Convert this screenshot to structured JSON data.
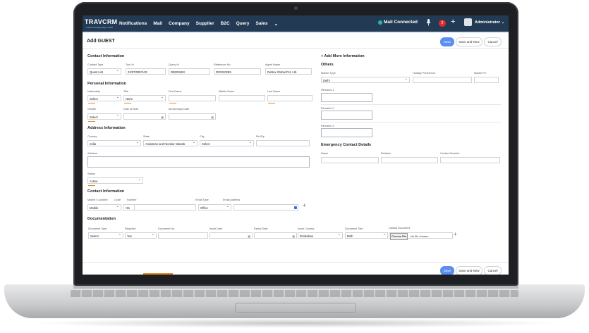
{
  "topbar": {
    "logo": "TRAVCRM",
    "logo_sub": "Travel & Holiday Mgmt CRM",
    "nav": [
      "Notifications",
      "Mail",
      "Company",
      "Supplier",
      "B2C",
      "Query",
      "Sales"
    ],
    "mail_status": "Mail Connected",
    "notifications_count": "2",
    "user": "Administrator"
  },
  "page": {
    "title": "Add GUEST",
    "save": "Save",
    "save_new": "Save and New",
    "cancel": "Cancel"
  },
  "contact_info": {
    "title": "Contact Information",
    "contact_type_label": "Contact Type",
    "contact_type": "Quest List",
    "tour_id_label": "Tour Id",
    "tour_id": "22/07/0007/AD",
    "query_id_label": "Query Id",
    "query_id": "DB200453",
    "ref_label": "Reference No",
    "ref": "R20220255",
    "agent_label": "Agent Name",
    "agent": "DeBox Global Pvt. Ltd."
  },
  "personal": {
    "title": "Personal Information",
    "nationality_label": "Nationality",
    "nationality": "Select",
    "title_label": "Title",
    "title_value": "None",
    "first_label": "First Name",
    "middle_label": "Middle Name",
    "last_label": "Last Name",
    "gender_label": "Gender",
    "gender": "Select",
    "dob_label": "Date of Birth",
    "anniv_label": "Anniversary Date"
  },
  "address": {
    "title": "Address Information",
    "country_label": "Country",
    "country": "India",
    "state_label": "State",
    "state": "Andaman and Nicobar Islands",
    "city_label": "City",
    "city": "Select",
    "pin_label": "Pin/Zip",
    "address_label": "Address",
    "status_label": "Status",
    "status": "Active"
  },
  "contact2": {
    "title": "Contact Information",
    "mobile_label": "Mobile / Landline",
    "mobile": "Mobile",
    "code_label": "Code",
    "code": "+91",
    "number_label": "Number",
    "email_type_label": "Email Type",
    "email_type": "Office",
    "email_label": "Email Address"
  },
  "documentation": {
    "title": "Documentation",
    "doc_type_label": "Document Type",
    "doc_type": "Select",
    "required_label": "Required",
    "required": "Yes",
    "doc_no_label": "Document No.",
    "issue_label": "Issue Date",
    "expiry_label": "Expiry Date",
    "issue_country_label": "Issue Country",
    "issue_country": "Zimbabwe",
    "doc_title_label": "Document Title",
    "doc_title": "Both",
    "upload_label": "Upload Document",
    "choose_file": "Choose File",
    "no_file": "No file chosen"
  },
  "others": {
    "add_more": "+ Add More Information",
    "title": "Others",
    "market_label": "Market Type",
    "market": "Delhi",
    "holiday_label": "Holiday Preference",
    "mobile_pri_label": "Mobile Pri",
    "remarks1": "Remarks 1",
    "remarks2": "Remarks 2",
    "remarks3": "Remarks 3"
  },
  "emergency": {
    "title": "Emergency Contact Details",
    "name_label": "Name",
    "relation_label": "Relation",
    "contact_label": "Contact Number"
  },
  "colors": {
    "topbar": "#223a53",
    "primary": "#5b8ef0",
    "accent": "#e7872b"
  }
}
